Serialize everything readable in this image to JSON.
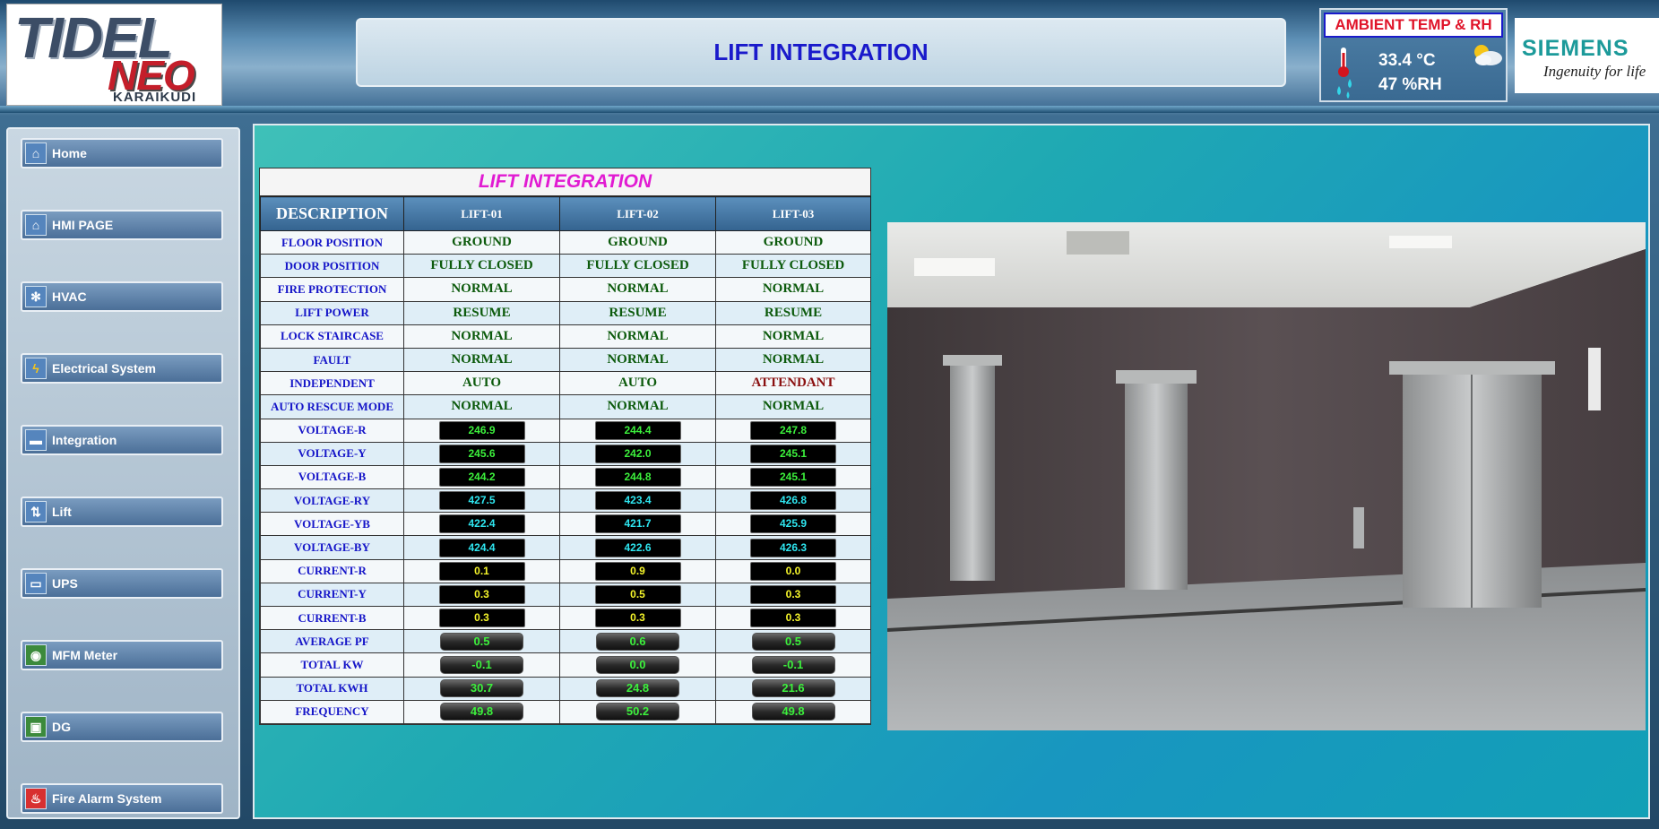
{
  "header": {
    "logo": {
      "main": "TIDEL",
      "neo": "NEO",
      "sub": "KARAIKUDI"
    },
    "title": "LIFT INTEGRATION",
    "ambient": {
      "title": "AMBIENT TEMP & RH",
      "temp": "33.4 °C",
      "rh": "47 %RH"
    },
    "siemens": {
      "name": "SIEMENS",
      "tagline": "Ingenuity for life"
    }
  },
  "sidebar": {
    "items": [
      {
        "label": "Home",
        "icon": "home-icon"
      },
      {
        "label": "HMI PAGE",
        "icon": "home-icon"
      },
      {
        "label": "HVAC",
        "icon": "fan-icon"
      },
      {
        "label": "Electrical System",
        "icon": "lightning-icon"
      },
      {
        "label": "Integration",
        "icon": "folder-icon"
      },
      {
        "label": "Lift",
        "icon": "elevator-icon"
      },
      {
        "label": "UPS",
        "icon": "battery-icon"
      },
      {
        "label": "MFM Meter",
        "icon": "meter-icon"
      },
      {
        "label": "DG",
        "icon": "generator-icon"
      },
      {
        "label": "Fire Alarm System",
        "icon": "fire-icon"
      }
    ]
  },
  "table": {
    "title": "LIFT INTEGRATION",
    "headers": [
      "DESCRIPTION",
      "LIFT-01",
      "LIFT-02",
      "LIFT-03"
    ],
    "rows": [
      {
        "label": "FLOOR POSITION",
        "kind": "status",
        "values": [
          "GROUND",
          "GROUND",
          "GROUND"
        ]
      },
      {
        "label": "DOOR POSITION",
        "kind": "status",
        "values": [
          "FULLY CLOSED",
          "FULLY CLOSED",
          "FULLY CLOSED"
        ]
      },
      {
        "label": "FIRE PROTECTION",
        "kind": "status",
        "values": [
          "NORMAL",
          "NORMAL",
          "NORMAL"
        ]
      },
      {
        "label": "LIFT POWER",
        "kind": "status",
        "values": [
          "RESUME",
          "RESUME",
          "RESUME"
        ]
      },
      {
        "label": "LOCK STAIRCASE",
        "kind": "status",
        "values": [
          "NORMAL",
          "NORMAL",
          "NORMAL"
        ]
      },
      {
        "label": "FAULT",
        "kind": "status",
        "values": [
          "NORMAL",
          "NORMAL",
          "NORMAL"
        ]
      },
      {
        "label": "INDEPENDENT",
        "kind": "status",
        "values": [
          "AUTO",
          "AUTO",
          "ATTENDANT"
        ]
      },
      {
        "label": "AUTO RESCUE MODE",
        "kind": "status",
        "values": [
          "NORMAL",
          "NORMAL",
          "NORMAL"
        ]
      },
      {
        "label": "VOLTAGE-R",
        "kind": "green",
        "values": [
          "246.9",
          "244.4",
          "247.8"
        ]
      },
      {
        "label": "VOLTAGE-Y",
        "kind": "green",
        "values": [
          "245.6",
          "242.0",
          "245.1"
        ]
      },
      {
        "label": "VOLTAGE-B",
        "kind": "green",
        "values": [
          "244.2",
          "244.8",
          "245.1"
        ]
      },
      {
        "label": "VOLTAGE-RY",
        "kind": "cyan",
        "values": [
          "427.5",
          "423.4",
          "426.8"
        ]
      },
      {
        "label": "VOLTAGE-YB",
        "kind": "cyan",
        "values": [
          "422.4",
          "421.7",
          "425.9"
        ]
      },
      {
        "label": "VOLTAGE-BY",
        "kind": "cyan",
        "values": [
          "424.4",
          "422.6",
          "426.3"
        ]
      },
      {
        "label": "CURRENT-R",
        "kind": "yellow",
        "values": [
          "0.1",
          "0.9",
          "0.0"
        ]
      },
      {
        "label": "CURRENT-Y",
        "kind": "yellow",
        "values": [
          "0.3",
          "0.5",
          "0.3"
        ]
      },
      {
        "label": "CURRENT-B",
        "kind": "yellow",
        "values": [
          "0.3",
          "0.3",
          "0.3"
        ]
      },
      {
        "label": "AVERAGE PF",
        "kind": "pill",
        "values": [
          "0.5",
          "0.6",
          "0.5"
        ]
      },
      {
        "label": "TOTAL KW",
        "kind": "pill",
        "values": [
          "-0.1",
          "0.0",
          "-0.1"
        ]
      },
      {
        "label": "TOTAL KWH",
        "kind": "pill",
        "values": [
          "30.7",
          "24.8",
          "21.6"
        ]
      },
      {
        "label": "FREQUENCY",
        "kind": "pill",
        "values": [
          "49.8",
          "50.2",
          "49.8"
        ]
      }
    ]
  },
  "colors": {
    "title_blue": "#1a1acb",
    "ambient_red": "#e0142a",
    "table_title_magenta": "#e11bd2",
    "status_green": "#0c5a0c",
    "attendant_red": "#8a1010",
    "lcd_green": "#3cf03c",
    "lcd_cyan": "#2ee6f0",
    "lcd_yellow": "#f5f52a"
  }
}
